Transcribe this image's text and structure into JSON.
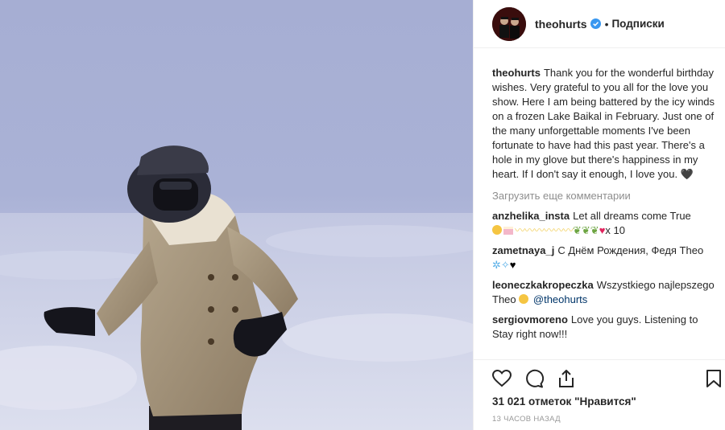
{
  "post": {
    "username": "theohurts",
    "follow_label": "Подписки",
    "separator": "•"
  },
  "caption": {
    "username": "theohurts",
    "text": "Thank you for the wonderful birthday wishes. Very grateful to you all for the love you show. Here I am being battered by the icy winds on a frozen Lake Baikal in February. Just one of the many unforgettable moments I've been fortunate to have had this past year. There's a hole in my glove but there's happiness in my heart. If I don't say it enough, I love you. 🖤"
  },
  "load_more_label": "Загрузить еще комментарии",
  "comments": [
    {
      "username": "anzhelika_insta",
      "text": "Let all dreams come True",
      "trail": "x 10"
    },
    {
      "username": "zametnaya_j",
      "text": "С Днём Рождения, Федя Theo"
    },
    {
      "username": "leoneczkakropeczka",
      "text": "Wszystkiego najlepszego Theo",
      "mention": "@theohurts"
    },
    {
      "username": "sergiovmoreno",
      "text": "Love you guys. Listening to Stay right now!!!"
    }
  ],
  "likes_label": "31 021 отметок \"Нравится\"",
  "time_label": "13 часов назад",
  "icons": [
    "verified-badge-icon",
    "heart-icon",
    "comment-icon",
    "share-icon",
    "bookmark-icon"
  ],
  "colors": {
    "verified": "#3897f0",
    "text": "#262626",
    "muted": "#8e8e8e",
    "mention": "#003569"
  }
}
